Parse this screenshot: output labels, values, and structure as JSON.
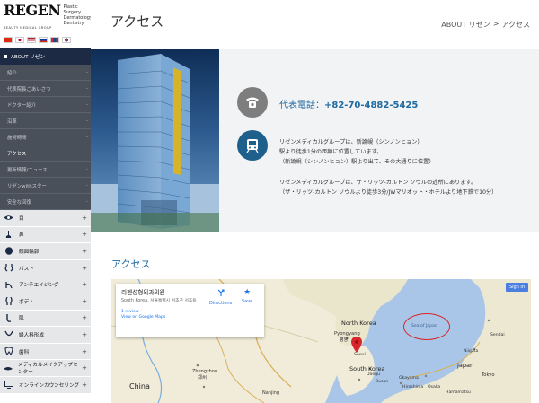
{
  "brand": {
    "logo_word": "REGEN",
    "logo_sub": [
      "Plastic Surgery",
      "Dermatology",
      "Dentistry"
    ],
    "logo_group": "BEAUTY MEDICAL GROUP"
  },
  "flags": [
    {
      "name": "china-flag",
      "color": "#de2910"
    },
    {
      "name": "japan-flag",
      "color": "#ffffff"
    },
    {
      "name": "usa-flag",
      "color": "#3c3b6e"
    },
    {
      "name": "russia-flag",
      "color": "#0039a6"
    },
    {
      "name": "mongolia-flag",
      "color": "#c4272f"
    },
    {
      "name": "korea-flag",
      "color": "#ffffff"
    }
  ],
  "sidebar": {
    "about_label": "ABOUT リゼン",
    "sub_items": [
      {
        "label": "紹介",
        "active": false
      },
      {
        "label": "代表院長ごあいさつ",
        "active": false
      },
      {
        "label": "ドクター紹介",
        "active": false
      },
      {
        "label": "沿革",
        "active": false
      },
      {
        "label": "施術時間",
        "active": false
      },
      {
        "label": "アクセス",
        "active": true
      },
      {
        "label": "更新情報/ニュース",
        "active": false
      },
      {
        "label": "リゼンwithスター",
        "active": false
      },
      {
        "label": "安全な回復",
        "active": false
      }
    ],
    "categories": [
      {
        "label": "目",
        "icon": "eye-icon"
      },
      {
        "label": "鼻",
        "icon": "nose-icon"
      },
      {
        "label": "顔面輪郭",
        "icon": "face-contour-icon"
      },
      {
        "label": "バスト",
        "icon": "bust-icon"
      },
      {
        "label": "アンチエイジング",
        "icon": "anti-aging-icon"
      },
      {
        "label": "ボディ",
        "icon": "body-icon"
      },
      {
        "label": "肌",
        "icon": "skin-icon"
      },
      {
        "label": "婦人科形成",
        "icon": "gynecology-icon"
      },
      {
        "label": "歯科",
        "icon": "tooth-icon"
      },
      {
        "label": "メディカルメイクアップセンター",
        "icon": "makeup-icon"
      },
      {
        "label": "オンラインカウンセリング",
        "icon": "monitor-icon"
      }
    ]
  },
  "header": {
    "title": "アクセス",
    "breadcrumb_1": "ABOUT リゼン",
    "breadcrumb_sep": ">",
    "breadcrumb_2": "アクセス"
  },
  "info": {
    "phone_label": "代表電話：",
    "phone_number": "+82-70-4882-5425",
    "address1_lines": [
      "リゼンメディカルグループは、新論峴（シンノンヒョン）",
      "駅より徒歩1分の距離に位置しています。",
      "（新論峴（シンノンヒョン）駅より出て、その大通りに位置）"
    ],
    "address2_lines": [
      "リゼンメディカルグループは、ザ・リッツ-カルトン ソウルの近所にあります。",
      "（ザ・リッツ-カルトン ソウルより徒歩3分/JWマリオット・ホテルより地下鉄で10分）"
    ]
  },
  "access": {
    "title": "アクセス"
  },
  "map": {
    "card_name": "리젠성형외과의원",
    "card_address": "South Korea, 서울특별시 서초구 서초동",
    "card_reviews": "1 review",
    "card_link": "View on Google Maps",
    "directions": "Directions",
    "save": "Save",
    "signin": "Sign in",
    "labels": {
      "north_korea": "North Korea",
      "pyongyang": "Pyongyang",
      "pyongyang_kr": "평양",
      "south_korea": "South Korea",
      "sea_of_japan": "Sea of Japan",
      "japan": "Japan",
      "china": "China",
      "zhengzhou": "Zhengzhou",
      "zhengzhou_cn": "郑州",
      "nanjing": "Nanjing",
      "sendai": "Sendai",
      "niigata": "Niigata",
      "tokyo": "Tokyo",
      "osaka": "Osaka",
      "hiroshima": "Hiroshima",
      "hamamatsu": "Hamamatsu",
      "okayama": "Okayama",
      "seoul": "Seoul",
      "busan": "Busan",
      "daegu": "Daegu"
    }
  }
}
